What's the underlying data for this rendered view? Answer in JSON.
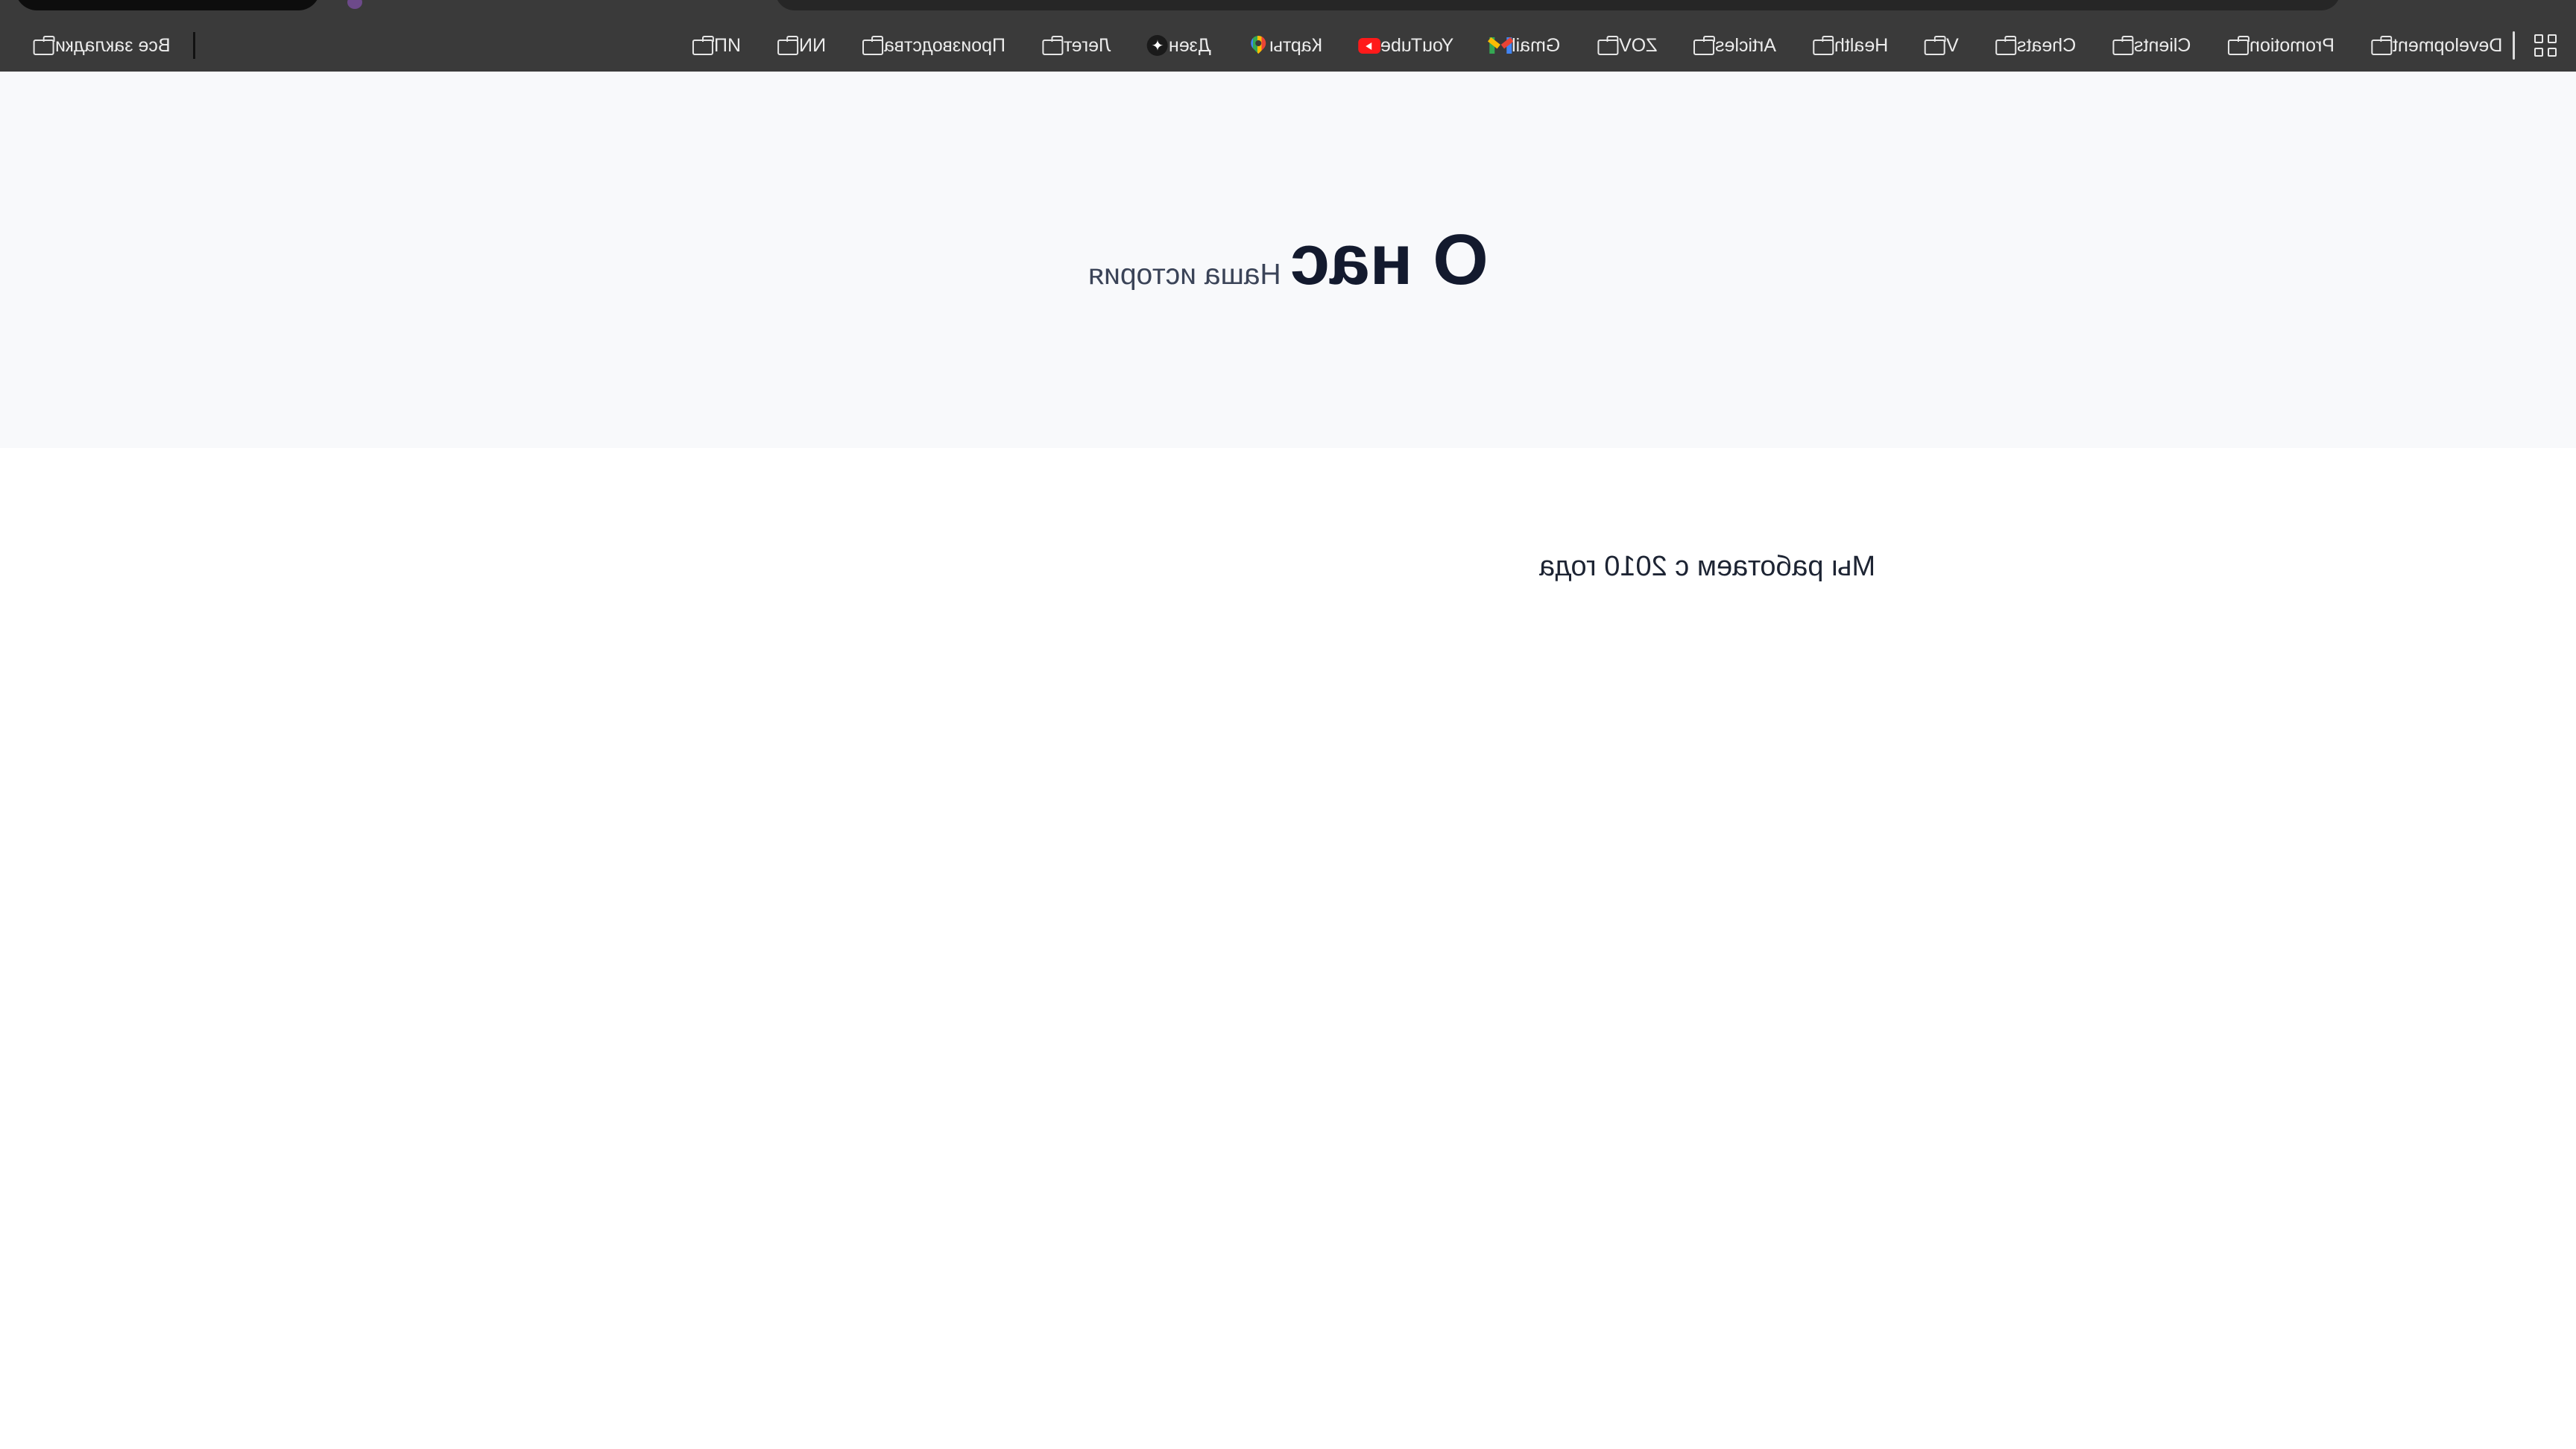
{
  "browser": {
    "bookmarks": [
      {
        "label": "Development",
        "icon": "folder-icon"
      },
      {
        "label": "Promotion",
        "icon": "folder-icon"
      },
      {
        "label": "Clients",
        "icon": "folder-icon"
      },
      {
        "label": "Cheats",
        "icon": "folder-icon"
      },
      {
        "label": "V",
        "icon": "folder-icon"
      },
      {
        "label": "Health",
        "icon": "folder-icon"
      },
      {
        "label": "Articles",
        "icon": "folder-icon"
      },
      {
        "label": "ZOV",
        "icon": "folder-icon"
      },
      {
        "label": "Gmail",
        "icon": "gmail-icon"
      },
      {
        "label": "YouTube",
        "icon": "youtube-icon"
      },
      {
        "label": "Карты",
        "icon": "maps-icon"
      },
      {
        "label": "Дзен",
        "icon": "zen-icon"
      },
      {
        "label": "Легет",
        "icon": "folder-icon"
      },
      {
        "label": "Производства",
        "icon": "folder-icon"
      },
      {
        "label": "NN",
        "icon": "folder-icon"
      },
      {
        "label": "ИП",
        "icon": "folder-icon"
      }
    ],
    "all_bookmarks_label": "Все закладки",
    "apps_icon": "apps-grid-icon"
  },
  "hero": {
    "title": "О нас",
    "subtitle": "Наша история"
  },
  "main": {
    "intro_text": "Мы работаем с 2010 года"
  },
  "colors": {
    "browser_bar": "#3a3a3a",
    "hero_bg": "#f8f9fb",
    "title_text": "#131a2e"
  }
}
